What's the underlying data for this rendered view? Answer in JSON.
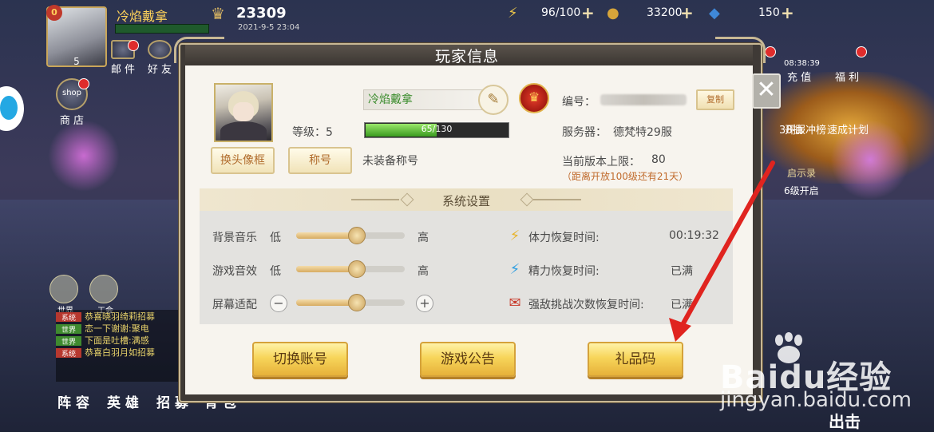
{
  "topbar": {
    "player_name": "冷焰戴拿",
    "vip_level": "0",
    "avatar_level": "5",
    "combat_power": "23309",
    "datetime": "2021-9-5 23:04",
    "stamina": "96/100",
    "gold": "33200",
    "diamonds": "150"
  },
  "left_menu": {
    "mail": "邮 件",
    "friends": "好 友",
    "shop_badge": "shop",
    "shop": "商 店",
    "world_voice": "世界",
    "guild_voice": "工会"
  },
  "right_menu": {
    "timer": "08:38:39",
    "recharge": "充 值",
    "welfare": "福 利",
    "draw": "38抽",
    "rank": "开服冲榜",
    "plan": "速成计划",
    "record": "启示录",
    "record_unlock": "6级开启"
  },
  "chat": {
    "lines": [
      {
        "tag": "系统",
        "text": "恭喜晓羽绮莉招募"
      },
      {
        "tag": "世界",
        "text": "恋一下谢谢:聚电"
      },
      {
        "tag": "世界",
        "text": "下面是吐槽:满感"
      },
      {
        "tag": "系统",
        "text": "恭喜白羽月如招募"
      }
    ]
  },
  "bottom_nav": {
    "lineup": "阵 容",
    "heroes": "英 雄",
    "recruit": "招 募",
    "bag": "背 包",
    "sortie": "出击"
  },
  "dialog": {
    "title": "玩家信息",
    "close": "✕",
    "name": "冷焰戴拿",
    "level_label": "等级：5",
    "exp_text": "65/130",
    "exp_progress": 0.5,
    "change_frame_button": "换头像框",
    "title_button": "称号",
    "no_title": "未装备称号",
    "id_label": "编号：",
    "copy_button": "复制",
    "server_label": "服务器：",
    "server_value": "德梵特29服",
    "version_cap_label": "当前版本上限：",
    "version_cap_value": "80",
    "version_note": "（距离开放100级还有21天）",
    "section_title": "系统设置",
    "settings": {
      "bgm_label": "背景音乐",
      "bgm_low": "低",
      "bgm_high": "高",
      "bgm_level": 0.55,
      "sfx_label": "游戏音效",
      "sfx_low": "低",
      "sfx_high": "高",
      "sfx_level": 0.55,
      "screen_label": "屏幕适配",
      "screen_level": 0.55
    },
    "recovery": {
      "stamina_label": "体力恢复时间:",
      "stamina_value": "00:19:32",
      "energy_label": "精力恢复时间:",
      "energy_value": "已满",
      "challenge_label": "强敌挑战次数恢复时间:",
      "challenge_value": "已满"
    },
    "buttons": {
      "switch_account": "切换账号",
      "announcement": "游戏公告",
      "gift_code": "礼品码"
    }
  },
  "watermark": {
    "logo": "Baidu经验",
    "url": "jingyan.baidu.com"
  },
  "colors": {
    "accent_gold": "#e6b13a",
    "name_green": "#3a8c2c",
    "arrow_red": "#e0241f"
  }
}
